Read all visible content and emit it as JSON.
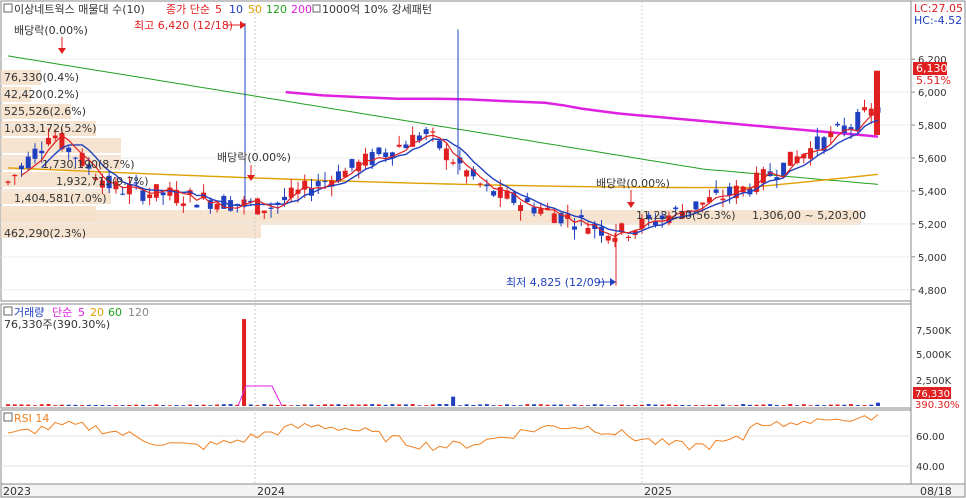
{
  "header": {
    "title": "이상네트웍스 매물대 수(10)",
    "ma_label": "종가 단순",
    "ma_periods": [
      "5",
      "10",
      "50",
      "120",
      "200"
    ],
    "ma_colors": [
      "#e02020",
      "#2040c0",
      "#e0a000",
      "#20a020",
      "#e020e0"
    ],
    "extra": "1000억 10% 강세패턴",
    "lc": "LC:27.05",
    "hc": "HC:-4.52"
  },
  "annotations": {
    "high": "최고 6,420 (12/18)",
    "low": "최저 4,825 (12/09)",
    "dividend": "배당락(0.00%)",
    "vp_range": "1,306,00 ~ 5,203,00",
    "vp_labels": [
      "76,330(0.4%)",
      "42,420(0.2%)",
      "525,526(2.6%)",
      "1,033,172(5.2%)",
      "1,730,190(8.7%)",
      "1,932,715(9.7%)",
      "1,404,581(7.0%)",
      "462,290(2.3%)",
      "11,23,230(56.3%)"
    ]
  },
  "price_axis": {
    "ticks": [
      "6,200",
      "6,000",
      "5,800",
      "5,600",
      "5,400",
      "5,200",
      "5,000",
      "4,800"
    ],
    "last_price": "6,130",
    "last_change": "5.51%"
  },
  "volume": {
    "title": "거래량",
    "ma_label": "단순",
    "ma_periods": [
      "5",
      "20",
      "60",
      "120"
    ],
    "current": "76,330주(390.30%)",
    "ticks": [
      "7,500K",
      "5,000K",
      "2,500K"
    ],
    "badge_value": "76,330",
    "badge_pct": "390.30%"
  },
  "rsi": {
    "title": "RSI 14",
    "ticks": [
      "60.00",
      "40.00"
    ]
  },
  "x_axis": {
    "labels": [
      "2023",
      "2024",
      "2025",
      "08/18"
    ]
  },
  "chart_data": {
    "type": "candlestick",
    "x_labels": [
      "2023",
      "2024",
      "2025",
      "08/18"
    ],
    "ylim": [
      4750,
      6450
    ],
    "y_ticks": [
      6200,
      6000,
      5800,
      5600,
      5400,
      5200,
      5000,
      4800
    ],
    "high": {
      "value": 6420,
      "date": "12/18"
    },
    "low": {
      "value": 4825,
      "date": "12/09"
    },
    "last_close": 6130,
    "series": [
      {
        "name": "종가 단순 5",
        "values": [
          5420,
          5450,
          5520,
          5560,
          5600,
          5540,
          5500,
          5450,
          5400,
          5380,
          5340,
          5310,
          5290,
          5300,
          5320,
          5340,
          5360,
          5380,
          5390,
          5400,
          5420,
          5450,
          5480,
          5500,
          5520,
          5560,
          5600,
          5640,
          5680,
          5700,
          5660,
          5600,
          5520,
          5440,
          5380,
          5340,
          5300,
          5280,
          5260,
          5240,
          5220,
          5200,
          5180,
          5160,
          5200,
          5240,
          5280,
          5320,
          5360,
          5400,
          5450,
          5500,
          5560,
          5620,
          5700,
          5780,
          5820,
          5860,
          5880,
          5900
        ]
      },
      {
        "name": "종가 단순 200",
        "values": [
          null,
          null,
          null,
          null,
          null,
          null,
          null,
          null,
          null,
          null,
          null,
          null,
          null,
          null,
          null,
          6000,
          5990,
          5980,
          5975,
          5970,
          5965,
          5960,
          5960,
          5960,
          5958,
          5955,
          5950,
          5945,
          5940,
          5935,
          5920,
          5900,
          5885,
          5870,
          5860,
          5850,
          5840,
          5830,
          5820,
          5810,
          5800,
          5790,
          5780,
          5770,
          5760,
          5750,
          5740,
          5730
        ]
      }
    ]
  }
}
